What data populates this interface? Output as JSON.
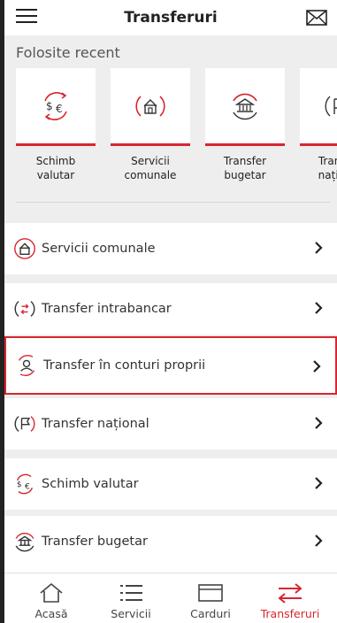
{
  "header": {
    "title": "Transferuri"
  },
  "recent": {
    "label": "Folosite recent",
    "cards": [
      {
        "label": "Schimb valutar",
        "icon": "currency-exchange-icon"
      },
      {
        "label": "Servicii comunale",
        "icon": "house-icon"
      },
      {
        "label": "Transfer bugetar",
        "icon": "bank-icon"
      },
      {
        "label": "Transfer național",
        "icon": "flag-icon"
      }
    ]
  },
  "list": {
    "items": [
      {
        "label": "Servicii comunale",
        "icon": "house-icon"
      },
      {
        "label": "Transfer intrabancar",
        "icon": "transfer-arrows-icon"
      },
      {
        "label": "Transfer în conturi proprii",
        "icon": "own-accounts-icon",
        "selected": true
      },
      {
        "label": "Transfer național",
        "icon": "flag-icon"
      },
      {
        "label": "Schimb valutar",
        "icon": "currency-exchange-icon"
      },
      {
        "label": "Transfer bugetar",
        "icon": "bank-icon"
      }
    ]
  },
  "bottom_nav": {
    "items": [
      {
        "label": "Acasă",
        "icon": "home-icon"
      },
      {
        "label": "Servicii",
        "icon": "list-icon"
      },
      {
        "label": "Carduri",
        "icon": "card-icon"
      },
      {
        "label": "Transferuri",
        "icon": "transfer-icon",
        "active": true
      }
    ]
  },
  "colors": {
    "accent": "#d8262f",
    "background": "#eeeeee",
    "text": "#222222"
  }
}
